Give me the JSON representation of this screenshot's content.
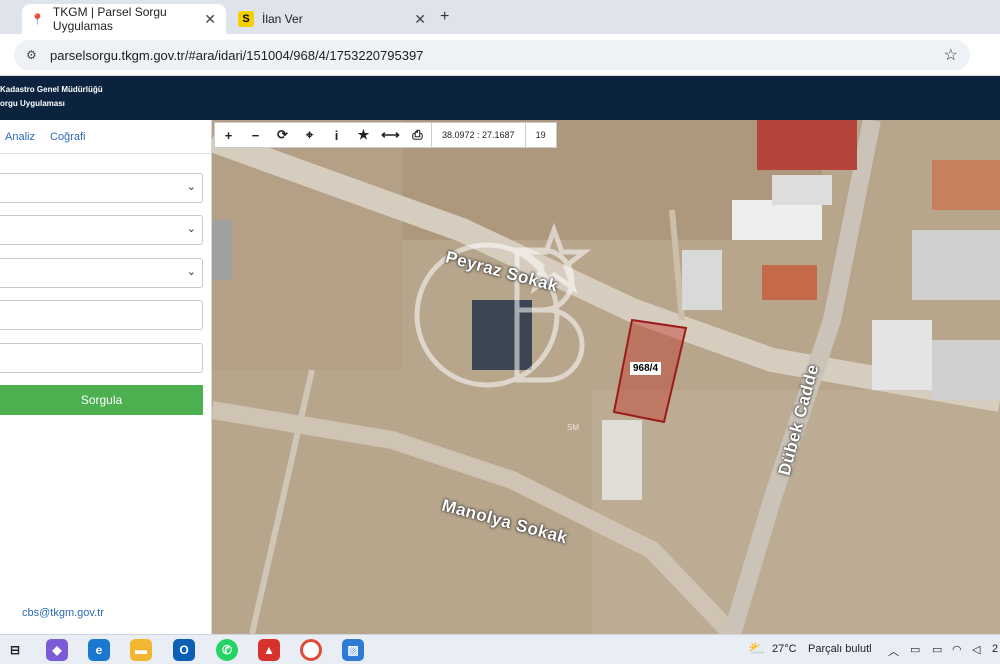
{
  "browser": {
    "tabs": [
      {
        "label": "TKGM | Parsel Sorgu Uygulamas",
        "icon": "map-pin-icon",
        "active": true
      },
      {
        "label": "İlan Ver",
        "icon": "s-logo-icon",
        "active": false
      }
    ],
    "url": "parselsorgu.tkgm.gov.tr/#ara/idari/151004/968/4/1753220795397"
  },
  "site": {
    "title_line1": "Kadastro Genel Müdürlüğü",
    "title_line2": "orgu Uygulaması"
  },
  "panel": {
    "tabs": [
      "Analiz",
      "Coğrafi"
    ],
    "query_button": "Sorgula",
    "email": "cbs@tkgm.gov.tr"
  },
  "map": {
    "toolbar": {
      "coordinate": "38.0972 : 27.1687",
      "zoom": "19"
    },
    "streets": {
      "peyraz": "Peyraz Sokak",
      "manolya": "Manolya Sokak",
      "dubek": "Dübek Cadde"
    },
    "parcel_label": "968/4",
    "parcel_color": "#c0392b",
    "watermark_mark": "SM"
  },
  "taskbar": {
    "weather_temp": "27°C",
    "weather_text": "Parçalı bulutl",
    "clock_partial": "2"
  }
}
